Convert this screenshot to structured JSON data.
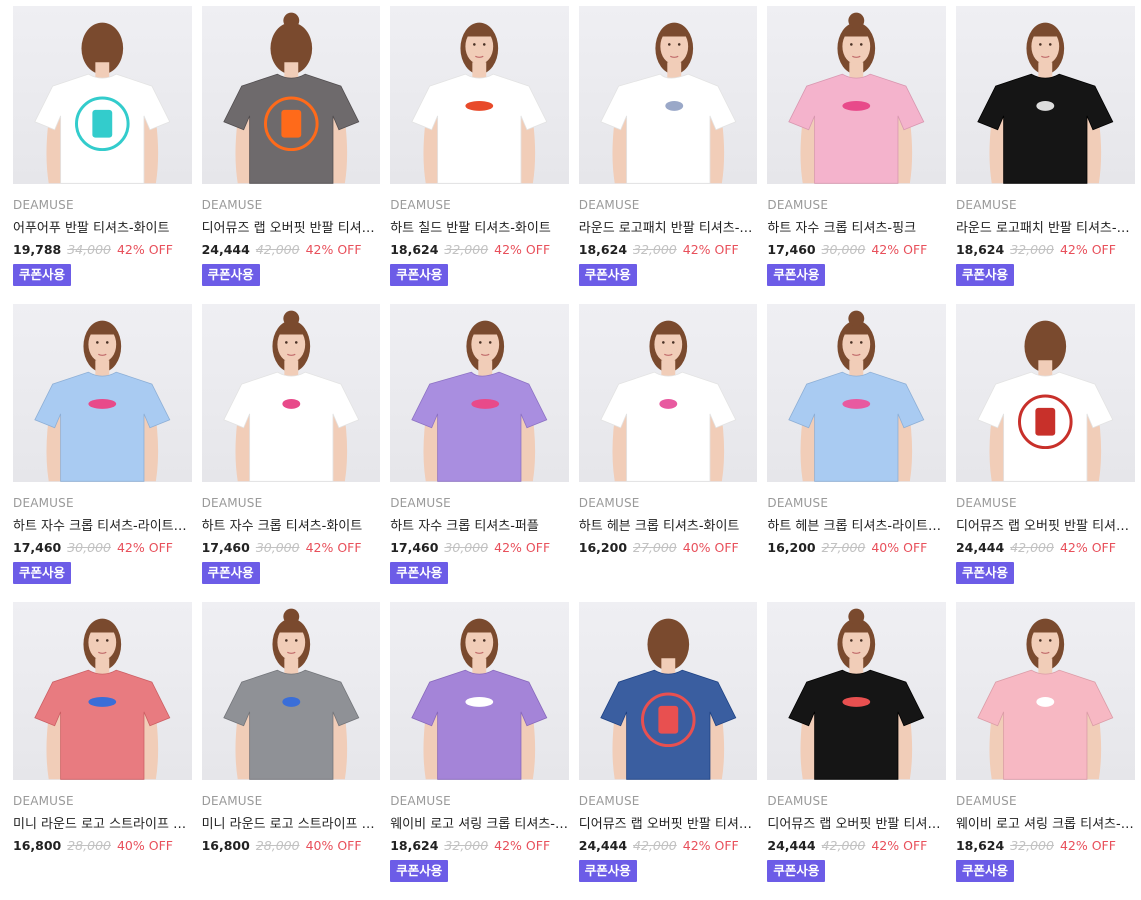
{
  "products": [
    {
      "brand": "DEAMUSE",
      "title": "어푸어푸 반팔 티셔츠-화이트",
      "price": "19,788",
      "original": "34,000",
      "discount": "42% OFF",
      "coupon": "쿠폰사용",
      "shirt_color": "#ffffff",
      "pose": "back",
      "print_color": "#33cccc"
    },
    {
      "brand": "DEAMUSE",
      "title": "디어뮤즈 랩 오버핏 반팔 티셔츠-차콜",
      "price": "24,444",
      "original": "42,000",
      "discount": "42% OFF",
      "coupon": "쿠폰사용",
      "shirt_color": "#6e6a6c",
      "pose": "back",
      "print_color": "#ff6a1a"
    },
    {
      "brand": "DEAMUSE",
      "title": "하트 칠드 반팔 티셔츠-화이트",
      "price": "18,624",
      "original": "32,000",
      "discount": "42% OFF",
      "coupon": "쿠폰사용",
      "shirt_color": "#ffffff",
      "pose": "front",
      "print_color": "#e84a2a"
    },
    {
      "brand": "DEAMUSE",
      "title": "라운드 로고패치 반팔 티셔츠-화이트",
      "price": "18,624",
      "original": "32,000",
      "discount": "42% OFF",
      "coupon": "쿠폰사용",
      "shirt_color": "#ffffff",
      "pose": "side",
      "print_color": "#9aa8c8"
    },
    {
      "brand": "DEAMUSE",
      "title": "하트 자수 크롭 티셔츠-핑크",
      "price": "17,460",
      "original": "30,000",
      "discount": "42% OFF",
      "coupon": "쿠폰사용",
      "shirt_color": "#f4b3cc",
      "pose": "front",
      "print_color": "#e84a8a"
    },
    {
      "brand": "DEAMUSE",
      "title": "라운드 로고패치 반팔 티셔츠-블랙",
      "price": "18,624",
      "original": "32,000",
      "discount": "42% OFF",
      "coupon": "쿠폰사용",
      "shirt_color": "#151515",
      "pose": "front",
      "print_color": "#dddddd"
    },
    {
      "brand": "DEAMUSE",
      "title": "하트 자수 크롭 티셔츠-라이트블루",
      "price": "17,460",
      "original": "30,000",
      "discount": "42% OFF",
      "coupon": "쿠폰사용",
      "shirt_color": "#a9cbf2",
      "pose": "front",
      "print_color": "#e84a8a"
    },
    {
      "brand": "DEAMUSE",
      "title": "하트 자수 크롭 티셔츠-화이트",
      "price": "17,460",
      "original": "30,000",
      "discount": "42% OFF",
      "coupon": "쿠폰사용",
      "shirt_color": "#ffffff",
      "pose": "front",
      "print_color": "#e84a8a"
    },
    {
      "brand": "DEAMUSE",
      "title": "하트 자수 크롭 티셔츠-퍼플",
      "price": "17,460",
      "original": "30,000",
      "discount": "42% OFF",
      "coupon": "쿠폰사용",
      "shirt_color": "#a98ee0",
      "pose": "side",
      "print_color": "#e84a8a"
    },
    {
      "brand": "DEAMUSE",
      "title": "하트 헤븐 크롭 티셔츠-화이트",
      "price": "16,200",
      "original": "27,000",
      "discount": "40% OFF",
      "coupon": "",
      "shirt_color": "#ffffff",
      "pose": "front",
      "print_color": "#e85aa0"
    },
    {
      "brand": "DEAMUSE",
      "title": "하트 헤븐 크롭 티셔츠-라이트블루",
      "price": "16,200",
      "original": "27,000",
      "discount": "40% OFF",
      "coupon": "",
      "shirt_color": "#a9cbf2",
      "pose": "front",
      "print_color": "#e85aa0"
    },
    {
      "brand": "DEAMUSE",
      "title": "디어뮤즈 랩 오버핏 반팔 티셔츠-화이트",
      "price": "24,444",
      "original": "42,000",
      "discount": "42% OFF",
      "coupon": "쿠폰사용",
      "shirt_color": "#ffffff",
      "pose": "back",
      "print_color": "#c8302a"
    },
    {
      "brand": "DEAMUSE",
      "title": "미니 라운드 로고 스트라이프 크롭 티셔츠-레드",
      "price": "16,800",
      "original": "28,000",
      "discount": "40% OFF",
      "coupon": "",
      "shirt_color": "#e87b80",
      "pose": "front",
      "print_color": "#3a6ed8"
    },
    {
      "brand": "DEAMUSE",
      "title": "미니 라운드 로고 스트라이프 크롭 티셔츠-그레이",
      "price": "16,800",
      "original": "28,000",
      "discount": "40% OFF",
      "coupon": "",
      "shirt_color": "#8f9196",
      "pose": "front",
      "print_color": "#3a6ed8"
    },
    {
      "brand": "DEAMUSE",
      "title": "웨이비 로고 셔링 크롭 티셔츠-퍼플",
      "price": "18,624",
      "original": "32,000",
      "discount": "42% OFF",
      "coupon": "쿠폰사용",
      "shirt_color": "#a484d8",
      "pose": "front",
      "print_color": "#ffffff"
    },
    {
      "brand": "DEAMUSE",
      "title": "디어뮤즈 랩 오버핏 반팔 티셔츠-블루",
      "price": "24,444",
      "original": "42,000",
      "discount": "42% OFF",
      "coupon": "쿠폰사용",
      "shirt_color": "#3a5ea0",
      "pose": "back",
      "print_color": "#e85050"
    },
    {
      "brand": "DEAMUSE",
      "title": "디어뮤즈 랩 오버핏 반팔 티셔츠-블랙",
      "price": "24,444",
      "original": "42,000",
      "discount": "42% OFF",
      "coupon": "쿠폰사용",
      "shirt_color": "#151515",
      "pose": "front",
      "print_color": "#e85050"
    },
    {
      "brand": "DEAMUSE",
      "title": "웨이비 로고 셔링 크롭 티셔츠-핑크",
      "price": "18,624",
      "original": "32,000",
      "discount": "42% OFF",
      "coupon": "쿠폰사용",
      "shirt_color": "#f7b8c3",
      "pose": "front",
      "print_color": "#ffffff"
    }
  ]
}
